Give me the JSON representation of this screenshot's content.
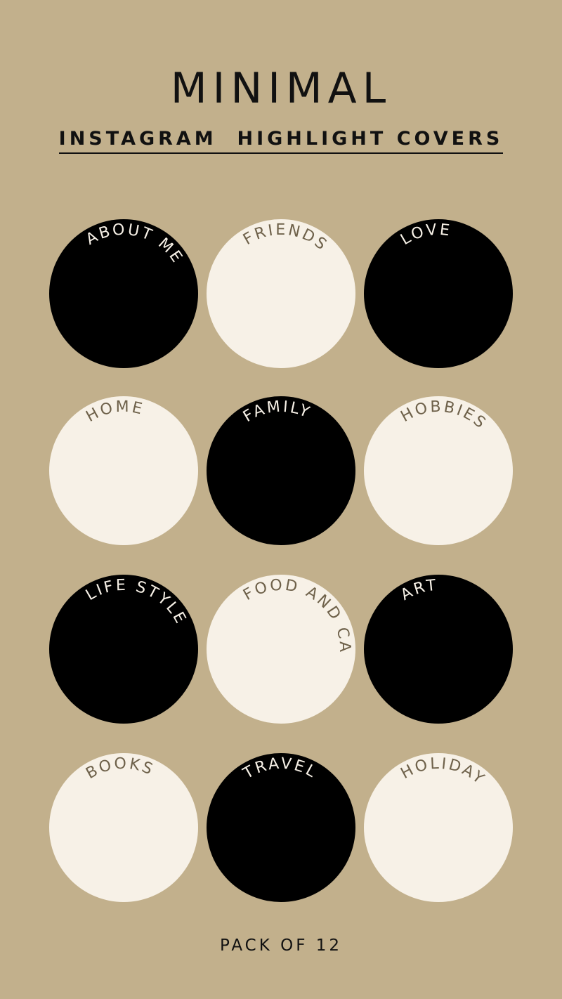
{
  "title": "MINIMAL",
  "subtitle": "INSTAGRAM  HIGHLIGHT COVERS",
  "footer": "PACK OF 12",
  "colors": {
    "background": "#c2b08c",
    "black_circle": "#000000",
    "cream_circle": "#f7f1e7",
    "text_on_black": "#f7f1e7",
    "text_on_cream": "#6e614a"
  },
  "covers": [
    {
      "label": "ABOUT ME",
      "style": "black"
    },
    {
      "label": "FRIENDS",
      "style": "cream"
    },
    {
      "label": "LOVE",
      "style": "black"
    },
    {
      "label": "HOME",
      "style": "cream"
    },
    {
      "label": "FAMILY",
      "style": "black"
    },
    {
      "label": "HOBBIES",
      "style": "cream"
    },
    {
      "label": "LIFE STYLE",
      "style": "black"
    },
    {
      "label": "FOOD AND CAFE",
      "style": "cream"
    },
    {
      "label": "ART",
      "style": "black"
    },
    {
      "label": "BOOKS",
      "style": "cream"
    },
    {
      "label": "TRAVEL",
      "style": "black"
    },
    {
      "label": "HOLIDAY",
      "style": "cream"
    }
  ]
}
